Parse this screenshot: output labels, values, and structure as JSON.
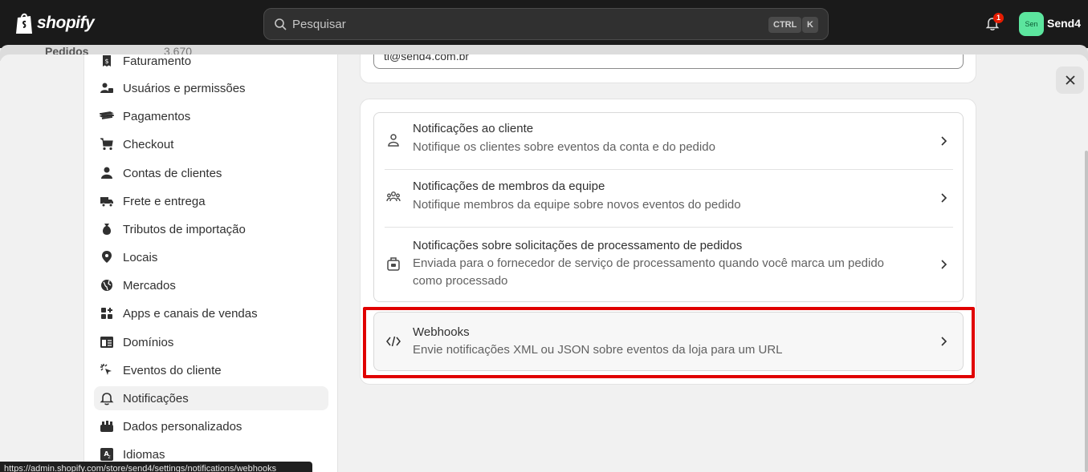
{
  "topbar": {
    "logo_text": "shopify",
    "search_placeholder": "Pesquisar",
    "shortcut_ctrl": "CTRL",
    "shortcut_k": "K",
    "notification_count": "1",
    "avatar_initials": "Sen",
    "store_name": "Send4",
    "colors": {
      "bar": "#1a1a1a",
      "avatar": "#5ce59e",
      "badge": "#e51c00"
    }
  },
  "behind": {
    "label": "Pedidos",
    "value": "3.670"
  },
  "sidebar": {
    "items": [
      {
        "label": "Faturamento",
        "icon": "receipt-icon",
        "active": false
      },
      {
        "label": "Usuários e permissões",
        "icon": "users-icon",
        "active": false
      },
      {
        "label": "Pagamentos",
        "icon": "payments-icon",
        "active": false
      },
      {
        "label": "Checkout",
        "icon": "cart-icon",
        "active": false
      },
      {
        "label": "Contas de clientes",
        "icon": "person-icon",
        "active": false
      },
      {
        "label": "Frete e entrega",
        "icon": "truck-icon",
        "active": false
      },
      {
        "label": "Tributos de importação",
        "icon": "money-bag-icon",
        "active": false
      },
      {
        "label": "Locais",
        "icon": "location-pin-icon",
        "active": false
      },
      {
        "label": "Mercados",
        "icon": "globe-icon",
        "active": false
      },
      {
        "label": "Apps e canais de vendas",
        "icon": "apps-icon",
        "active": false
      },
      {
        "label": "Domínios",
        "icon": "domain-icon",
        "active": false
      },
      {
        "label": "Eventos do cliente",
        "icon": "cursor-icon",
        "active": false
      },
      {
        "label": "Notificações",
        "icon": "bell-icon",
        "active": true
      },
      {
        "label": "Dados personalizados",
        "icon": "database-icon",
        "active": false
      },
      {
        "label": "Idiomas",
        "icon": "translate-icon",
        "active": false
      }
    ]
  },
  "main": {
    "email_value": "ti@send4.com.br",
    "rows": [
      {
        "title": "Notificações ao cliente",
        "desc": "Notifique os clientes sobre eventos da conta e do pedido",
        "icon": "person-outline-icon"
      },
      {
        "title": "Notificações de membros da equipe",
        "desc": "Notifique membros da equipe sobre novos eventos do pedido",
        "icon": "team-icon"
      },
      {
        "title": "Notificações sobre solicitações de processamento de pedidos",
        "desc": "Enviada para o fornecedor de serviço de processamento quando você marca um pedido como processado",
        "icon": "fulfillment-icon"
      }
    ],
    "webhook": {
      "title": "Webhooks",
      "desc": "Envie notificações XML ou JSON sobre eventos da loja para um URL",
      "icon": "code-icon"
    },
    "highlight_color": "#e00000"
  },
  "status_url": "https://admin.shopify.com/store/send4/settings/notifications/webhooks"
}
